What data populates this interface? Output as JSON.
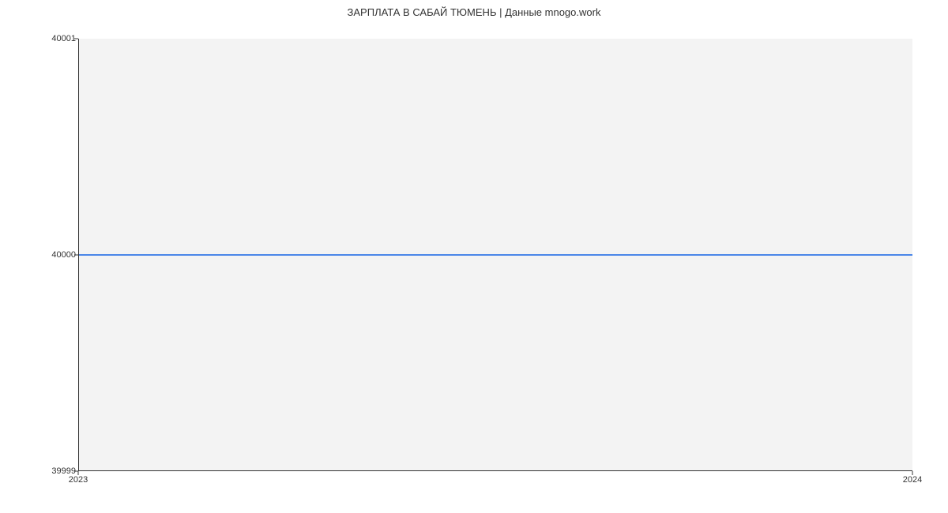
{
  "chart_data": {
    "type": "line",
    "title": "ЗАРПЛАТА В САБАЙ ТЮМЕНЬ | Данные mnogo.work",
    "xlabel": "",
    "ylabel": "",
    "x": [
      "2023",
      "2024"
    ],
    "values": [
      40000,
      40000
    ],
    "ylim": [
      39999,
      40001
    ],
    "y_ticks": [
      "39999",
      "40000",
      "40001"
    ],
    "x_ticks": [
      "2023",
      "2024"
    ]
  }
}
